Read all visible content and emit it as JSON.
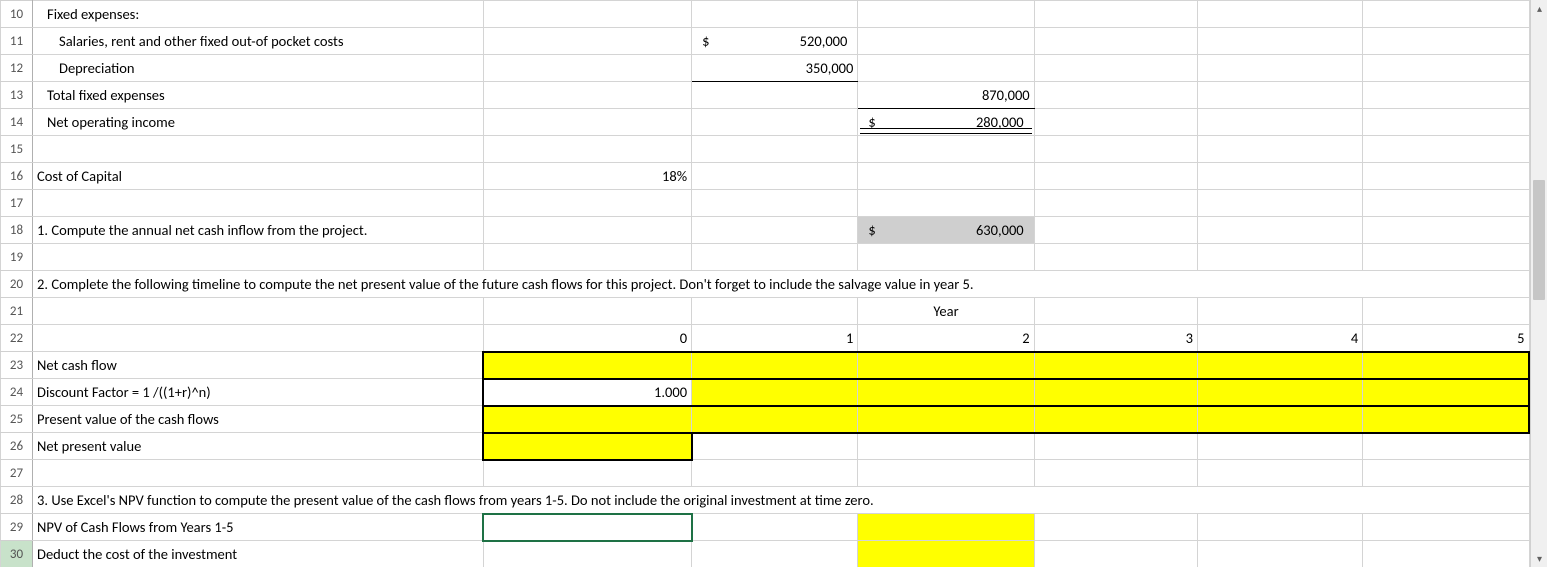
{
  "rows": {
    "r10": {
      "num": "10",
      "B": "Fixed expenses:"
    },
    "r11": {
      "num": "11",
      "B": "Salaries, rent and other fixed out-of pocket costs",
      "D_sym": "$",
      "D_val": "520,000"
    },
    "r12": {
      "num": "12",
      "B": "Depreciation",
      "D_val": "350,000"
    },
    "r13": {
      "num": "13",
      "B": "Total fixed expenses",
      "E_val": "870,000"
    },
    "r14": {
      "num": "14",
      "B": "Net operating income",
      "E_sym": "$",
      "E_val": "280,000"
    },
    "r15": {
      "num": "15"
    },
    "r16": {
      "num": "16",
      "B": "Cost of Capital",
      "C": "18%"
    },
    "r17": {
      "num": "17"
    },
    "r18": {
      "num": "18",
      "B": "1. Compute the annual net cash inflow from the project.",
      "E_sym": "$",
      "E_val": "630,000"
    },
    "r19": {
      "num": "19"
    },
    "r20": {
      "num": "20",
      "B": "2.  Complete the following timeline to compute the net present value of the future cash flows for this project.  Don't forget to include the salvage value in year 5."
    },
    "r21": {
      "num": "21",
      "E": "Year"
    },
    "r22": {
      "num": "22",
      "C": "0",
      "D": "1",
      "E": "2",
      "F": "3",
      "G": "4",
      "H": "5"
    },
    "r23": {
      "num": "23",
      "B": "Net cash flow"
    },
    "r24": {
      "num": "24",
      "B": "Discount Factor = 1 /((1+r)^n)",
      "C": "1.000"
    },
    "r25": {
      "num": "25",
      "B": "Present value of the cash flows"
    },
    "r26": {
      "num": "26",
      "B": "Net present value"
    },
    "r27": {
      "num": "27"
    },
    "r28": {
      "num": "28",
      "B": "3.  Use Excel's NPV function to compute the present value of the cash flows from years 1-5.  Do not include the original investment at time zero."
    },
    "r29": {
      "num": "29",
      "B": "NPV of Cash Flows from Years 1-5"
    },
    "r30": {
      "num": "30",
      "B": "Deduct the cost of the investment"
    }
  },
  "scroll": {
    "up": "▴",
    "down": "▾"
  }
}
